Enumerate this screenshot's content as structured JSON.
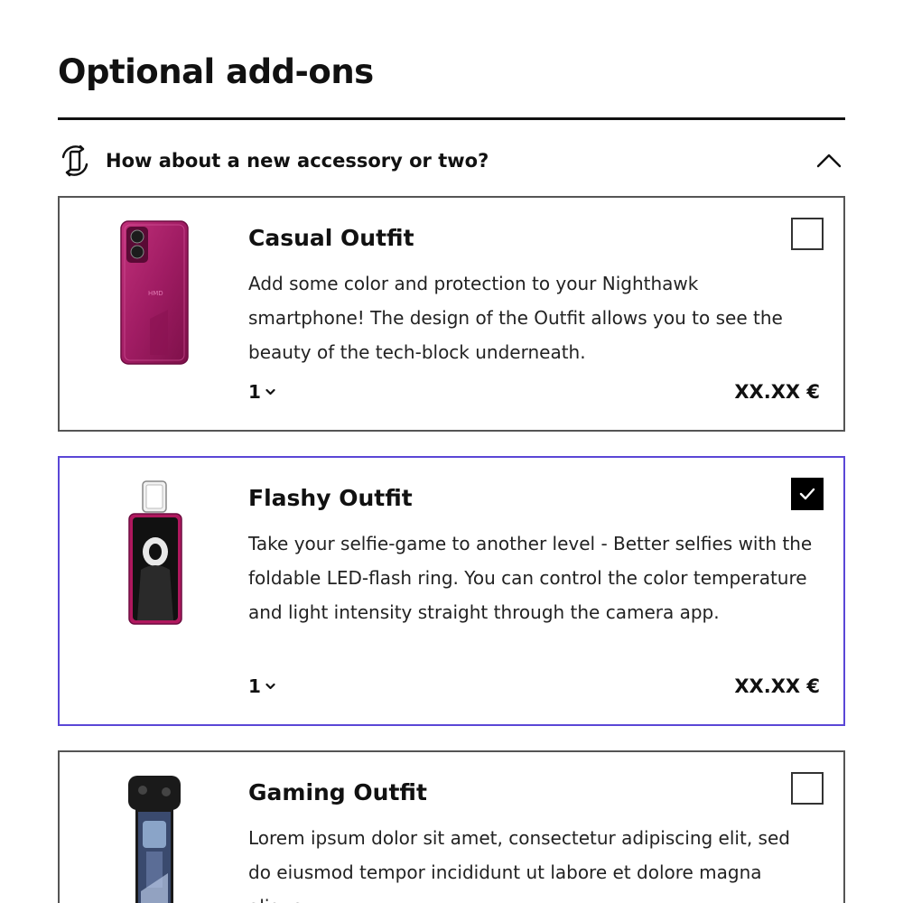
{
  "page": {
    "title": "Optional add-ons"
  },
  "section": {
    "label": "How about a new accessory or two?",
    "icon": "phone-rotate-icon",
    "expanded": true
  },
  "colors": {
    "text": "#111111",
    "card_border": "#555555",
    "selected_border": "#5b47d6",
    "checkbox_checked": "#000000"
  },
  "products": [
    {
      "title": "Casual Outfit",
      "description": "Add some color and protection to your Nighthawk smartphone! The design of the Outfit allows you to see the beauty of the tech-block underneath.",
      "quantity": "1",
      "price": "XX.XX €",
      "checked": false,
      "image": "pink-phone-case-image"
    },
    {
      "title": "Flashy Outfit",
      "description": "Take your selfie-game to another level - Better selfies with the foldable LED-flash ring. You can control the color temperature and light intensity straight through the camera app.",
      "quantity": "1",
      "price": "XX.XX €",
      "checked": true,
      "image": "phone-with-flash-ring-image"
    },
    {
      "title": "Gaming Outfit",
      "description": "Lorem ipsum dolor sit amet, consectetur adipiscing elit, sed do eiusmod tempor incididunt ut labore et dolore magna aliqua.",
      "checked": false,
      "image": "phone-with-game-controller-image"
    }
  ]
}
